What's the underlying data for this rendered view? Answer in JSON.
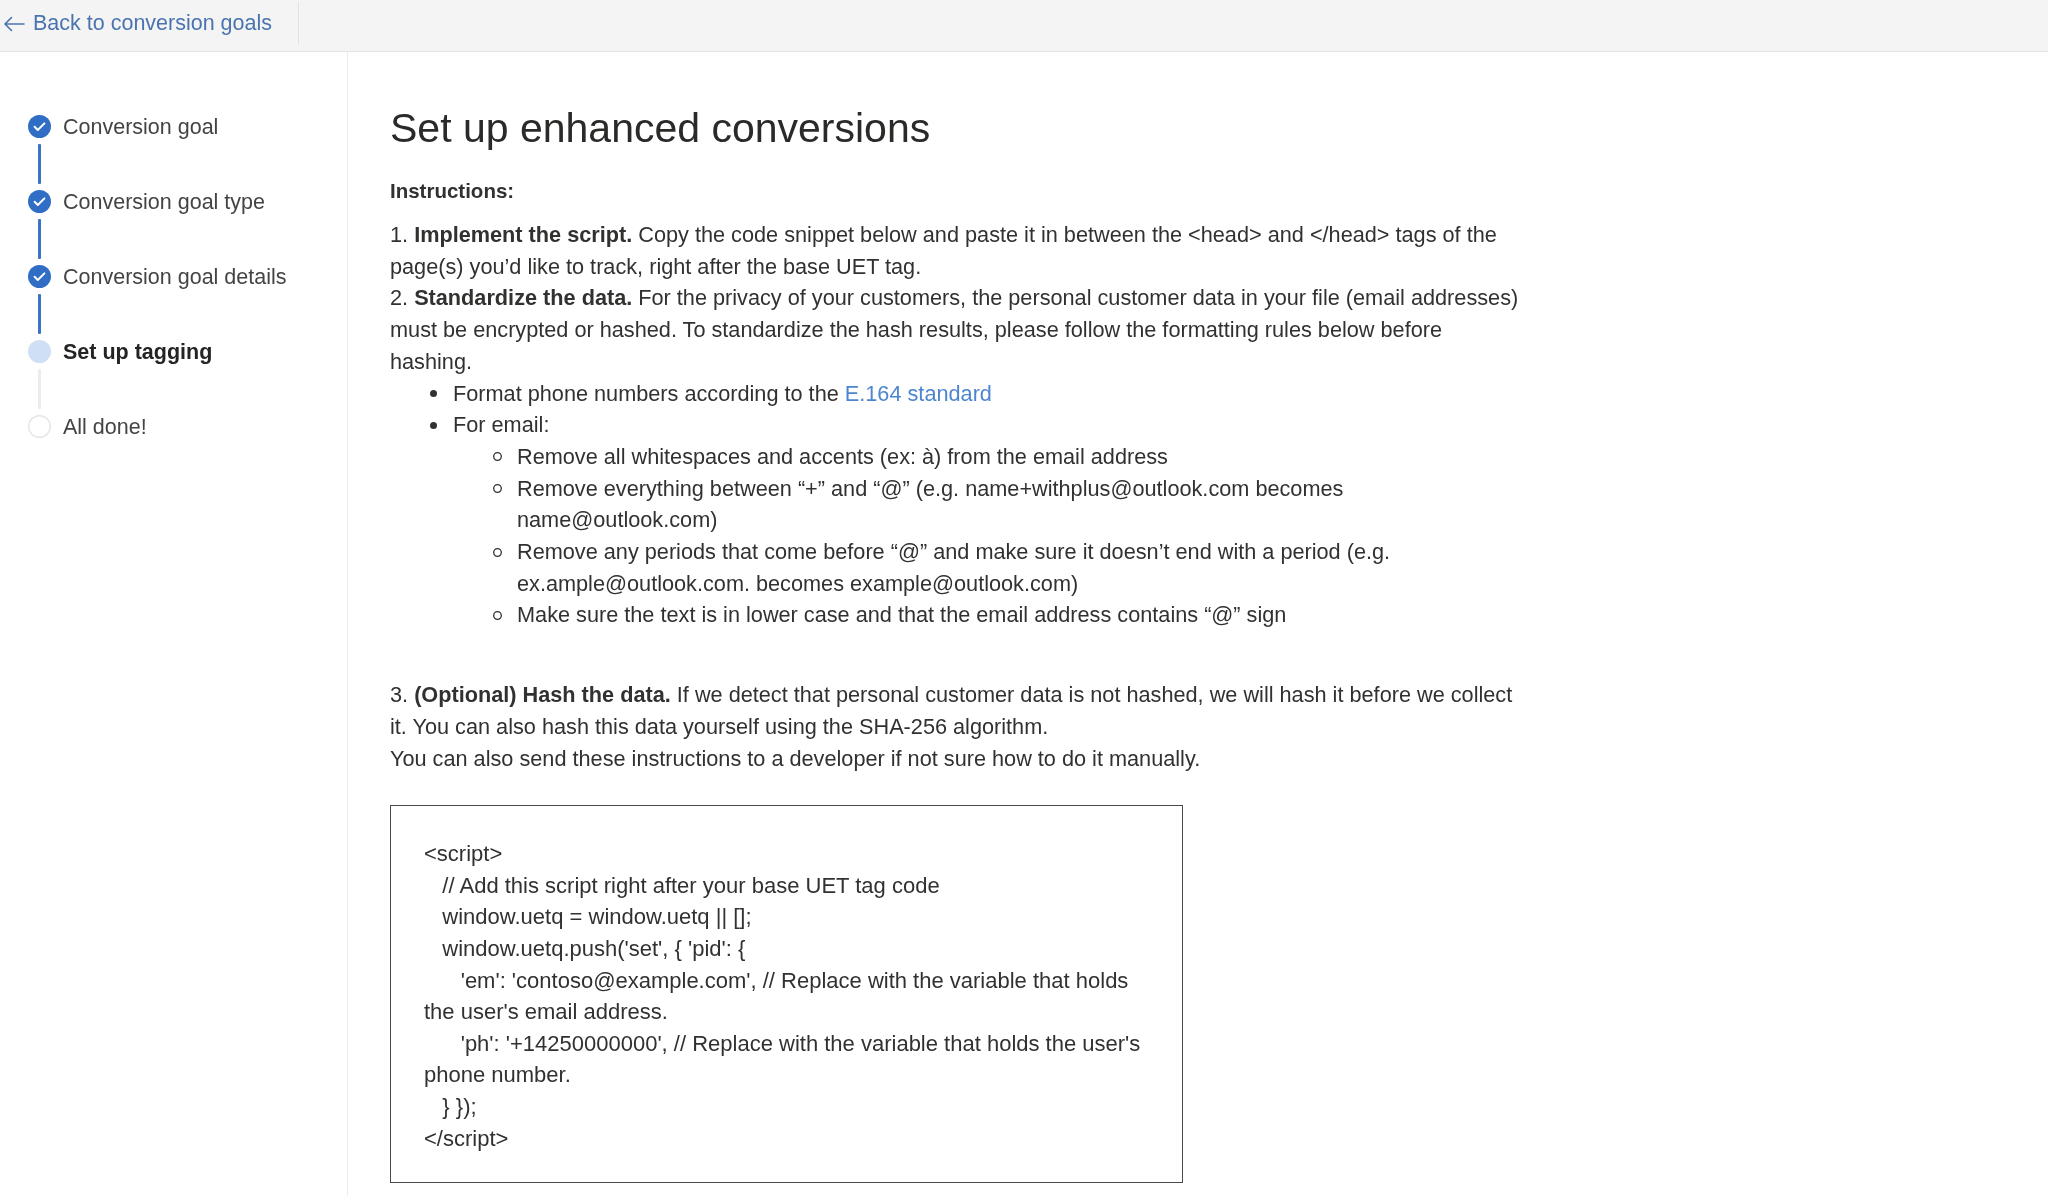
{
  "header": {
    "back_link": "Back to conversion goals"
  },
  "steps": [
    {
      "label": "Conversion goal",
      "completed": true,
      "selected": false
    },
    {
      "label": "Conversion goal type",
      "completed": true,
      "selected": false
    },
    {
      "label": "Conversion goal details",
      "completed": true,
      "selected": false
    },
    {
      "label": "Set up tagging",
      "completed": false,
      "selected": true
    },
    {
      "label": "All done!",
      "completed": false,
      "selected": false
    }
  ],
  "title": "Set up enhanced conversions",
  "instructions": {
    "heading": "Instructions:",
    "steps": [
      {
        "text": "1. **Implement the script.** Copy the code snippet below and paste it in between the <head> and </head> tags of the page(s) you’d like to track, right after the base UET tag."
      },
      {
        "text": "2. **Standardize the data.** For the privacy of your customers, the personal customer data in your file (email addresses) must be encrypted or hashed. To standardize the hash results, please follow the formatting rules below before hashing.",
        "rules": [
          {
            "text": "Format phone numbers according to the",
            "link": "E.164 standard"
          },
          {
            "text": "For email:",
            "children": [
              {
                "text": "Remove all whitespaces and accents (ex: à) from the email address"
              },
              {
                "text": "Remove everything between “+” and “@” (e.g. name+withplus@outlook.com becomes name@outlook.com)"
              },
              {
                "text": "Remove any periods that come before “@” and make sure it doesn’t end with a period (e.g. ex.ample@outlook.com. becomes example@outlook.com)"
              },
              {
                "text": "Make sure the text is in lower case and that the email address contains “@” sign"
              }
            ]
          }
        ]
      },
      {
        "text": "3. **(Optional) Hash the data.** If we detect that personal customer data is not hashed, we will hash it before we collect it. You can also hash this data yourself using the SHA-256 algorithm."
      }
    ],
    "note": "You can also send these instructions to a developer if not sure how to do it manually."
  },
  "code_snippet": "<script>\n   // Add this script right after your base UET tag code\n   window.uetq = window.uetq || [];\n   window.uetq.push('set', { 'pid': {\n      'em': 'contoso@example.com', // Replace with the variable that holds the user's email address.\n      'ph': '+14250000000', // Replace with the variable that holds the user's phone number.\n   } });\n</script>"
}
